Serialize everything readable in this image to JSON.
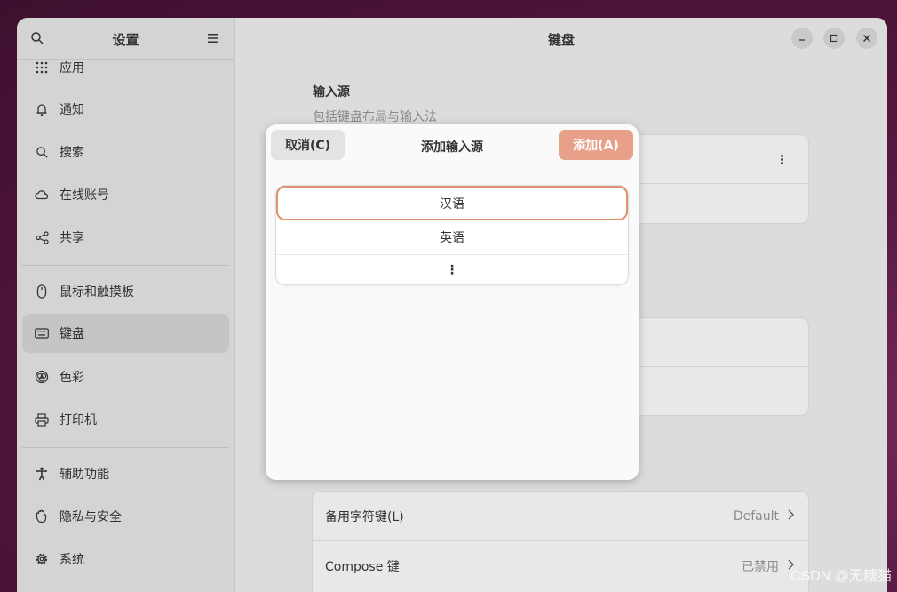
{
  "sidebar": {
    "title": "设置",
    "items": [
      {
        "label": "应用",
        "icon": "apps-grid-icon"
      },
      {
        "label": "通知",
        "icon": "bell-icon"
      },
      {
        "label": "搜索",
        "icon": "search-icon"
      },
      {
        "label": "在线账号",
        "icon": "cloud-icon"
      },
      {
        "label": "共享",
        "icon": "share-icon"
      },
      {
        "label": "鼠标和触摸板",
        "icon": "mouse-icon"
      },
      {
        "label": "键盘",
        "icon": "keyboard-icon",
        "active": true
      },
      {
        "label": "色彩",
        "icon": "color-icon"
      },
      {
        "label": "打印机",
        "icon": "printer-icon"
      },
      {
        "label": "辅助功能",
        "icon": "accessibility-icon"
      },
      {
        "label": "隐私与安全",
        "icon": "hand-icon"
      },
      {
        "label": "系统",
        "icon": "gear-icon"
      }
    ]
  },
  "main": {
    "title": "键盘",
    "input_sources": {
      "title": "输入源",
      "subtitle": "包括键盘布局与输入法"
    },
    "special_keys": [
      {
        "label": "备用字符键(L)",
        "value": "Default"
      },
      {
        "label": "Compose 键",
        "value": "已禁用"
      }
    ]
  },
  "dialog": {
    "title": "添加输入源",
    "cancel_label": "取消(C)",
    "add_label": "添加(A)",
    "languages": [
      "汉语",
      "英语"
    ],
    "more_glyph": "⋮"
  },
  "watermark": "CSDN @无糖猫",
  "colors": {
    "accent": "#e8a088",
    "selection_border": "#e0926f",
    "background": "#5a1a44"
  }
}
